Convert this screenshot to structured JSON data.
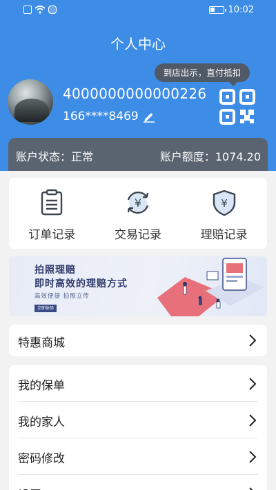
{
  "status_bar": {
    "time": "10:02"
  },
  "page_title": "个人中心",
  "user": {
    "id": "4000000000000226",
    "phone": "166****8469"
  },
  "qr": {
    "tip": "到店出示，直付抵扣"
  },
  "account": {
    "status": "账户状态：正常",
    "quota": "账户额度：1074.20"
  },
  "records": [
    {
      "label": "订单记录",
      "icon": "clipboard-list-icon"
    },
    {
      "label": "交易记录",
      "icon": "yuan-exchange-icon"
    },
    {
      "label": "理赔记录",
      "icon": "yuan-shield-icon"
    }
  ],
  "banner": {
    "title1": "拍照理赔",
    "title2": "即时高效的理赔方式",
    "subtitle": "高效便捷  拍照立传",
    "button": "立即体验"
  },
  "menu_top": [
    {
      "label": "特惠商城"
    }
  ],
  "menu_main": [
    {
      "label": "我的保单"
    },
    {
      "label": "我的家人"
    },
    {
      "label": "密码修改"
    },
    {
      "label": "设置"
    }
  ],
  "colors": {
    "primary": "#3d8ce6",
    "account_bar": "#5a6470",
    "tooltip": "#505a66"
  }
}
